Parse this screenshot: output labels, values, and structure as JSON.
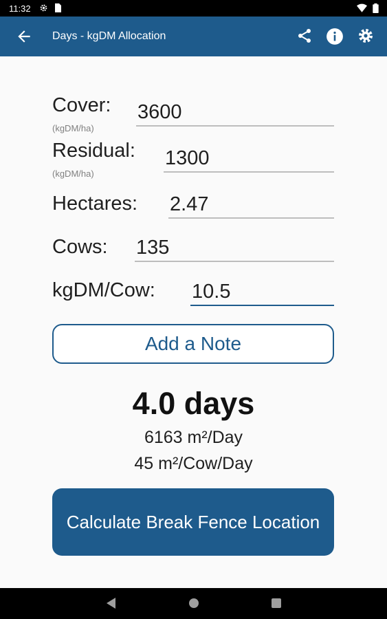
{
  "status_bar": {
    "time": "11:32"
  },
  "app_bar": {
    "title": "Days - kgDM Allocation"
  },
  "fields": {
    "cover": {
      "label": "Cover:",
      "unit": "(kgDM/ha)",
      "value": "3600"
    },
    "residual": {
      "label": "Residual:",
      "unit": "(kgDM/ha)",
      "value": "1300"
    },
    "hectares": {
      "label": "Hectares:",
      "value": "2.47"
    },
    "cows": {
      "label": "Cows:",
      "value": "135"
    },
    "kgdm_per_cow": {
      "label": "kgDM/Cow:",
      "value": "10.5"
    }
  },
  "note_button_label": "Add a Note",
  "results": {
    "days": "4.0 days",
    "area_per_day": "6163 m²/Day",
    "area_per_cow_day": "45 m²/Cow/Day"
  },
  "calculate_button_label": "Calculate Break Fence Location",
  "colors": {
    "primary": "#1e5b8c",
    "background": "#fafafa"
  },
  "icons": [
    "settings-icon",
    "storage-icon",
    "wifi-icon",
    "battery-icon",
    "back-arrow-icon",
    "share-icon",
    "info-icon",
    "gear-icon",
    "nav-back-icon",
    "nav-home-icon",
    "nav-recents-icon"
  ]
}
